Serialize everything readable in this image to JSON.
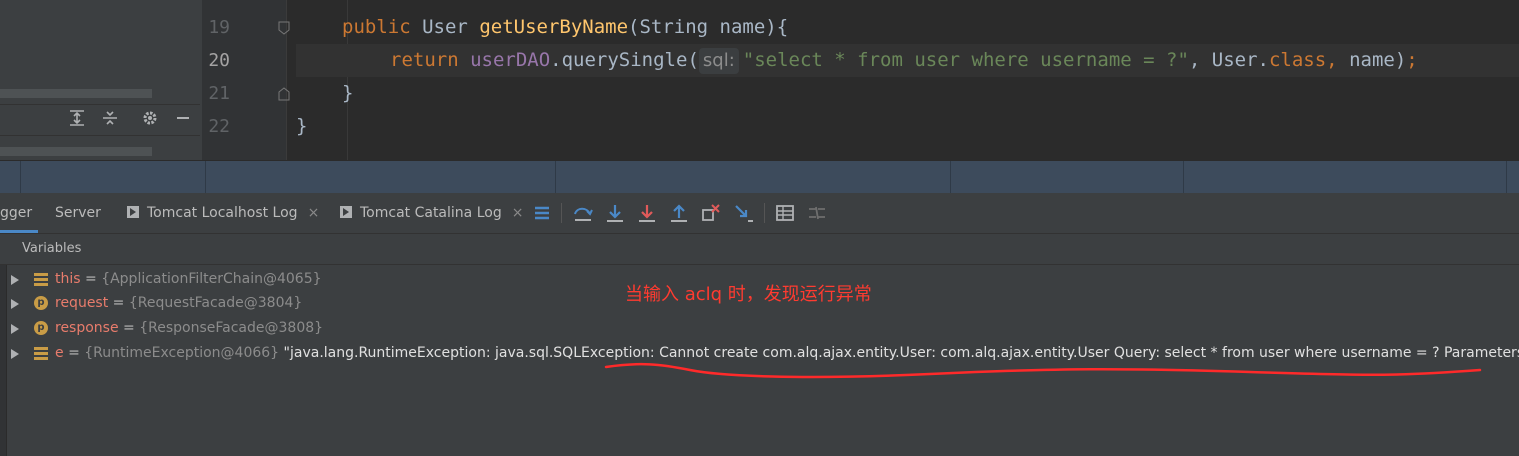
{
  "editor": {
    "lines": [
      {
        "num": "19"
      },
      {
        "num": "20"
      },
      {
        "num": "21"
      },
      {
        "num": "22"
      }
    ],
    "line19": {
      "kw": "public",
      "type": "User",
      "method": "getUserByName",
      "params": "(String name){"
    },
    "line20": {
      "kw": "return",
      "field": "userDAO",
      "call": ".querySingle(",
      "hint": "sql:",
      "str": "\"select * from user where username = ?\"",
      "mid": ", User.",
      "class_kw": "class",
      "comma": ",",
      "arg": " name)",
      "semi": ";"
    },
    "line21": {
      "text": "}"
    },
    "line22": {
      "text": "}"
    }
  },
  "tabs": {
    "debugger": "gger",
    "server": "Server",
    "tomcat_localhost": "Tomcat Localhost Log",
    "tomcat_catalina": "Tomcat Catalina Log",
    "close": "×"
  },
  "variables": {
    "title": "Variables",
    "rows": [
      {
        "name": "this",
        "eq": " = ",
        "type": "{ApplicationFilterChain@4065}",
        "value": ""
      },
      {
        "name": "request",
        "eq": " = ",
        "type": "{RequestFacade@3804}",
        "value": ""
      },
      {
        "name": "response",
        "eq": " = ",
        "type": "{ResponseFacade@3808}",
        "value": ""
      },
      {
        "name": "e",
        "eq": " = ",
        "type": "{RuntimeException@4066}",
        "value": " \"java.lang.RuntimeException: java.sql.SQLException: Cannot create com.alq.ajax.entity.User: com.alq.ajax.entity.User Query: select * from user where username = ? Parameters: [aclq]\""
      }
    ]
  },
  "annotation": "当输入 aclq 时，发现运行异常",
  "colors": {
    "annotation": "#ff3b30",
    "accent": "#4a88c7"
  }
}
